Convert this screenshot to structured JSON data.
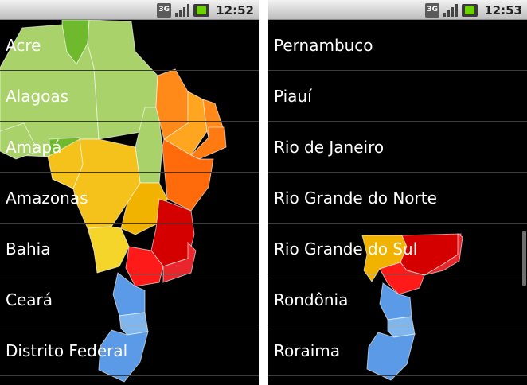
{
  "screens": [
    {
      "status": {
        "time": "12:52",
        "network_label": "3G"
      },
      "items": [
        {
          "label": "Acre"
        },
        {
          "label": "Alagoas"
        },
        {
          "label": "Amapá"
        },
        {
          "label": "Amazonas"
        },
        {
          "label": "Bahia"
        },
        {
          "label": "Ceará"
        },
        {
          "label": "Distrito Federal"
        }
      ]
    },
    {
      "status": {
        "time": "12:53",
        "network_label": "3G"
      },
      "items": [
        {
          "label": "Pernambuco"
        },
        {
          "label": "Piauí"
        },
        {
          "label": "Rio de Janeiro"
        },
        {
          "label": "Rio Grande do Norte"
        },
        {
          "label": "Rio Grande do Sul"
        },
        {
          "label": "Rondônia"
        },
        {
          "label": "Roraima"
        }
      ]
    }
  ],
  "map_colors": {
    "north_light": "#a9d26a",
    "north_dark": "#6fba2c",
    "northeast_orange": "#ff8a1a",
    "northeast_light": "#ffa51f",
    "central_yellow": "#f5c21b",
    "central_gold": "#f2b300",
    "southeast_red": "#d40000",
    "southeast_bright": "#ff1a1a",
    "south_blue": "#5a9ae6",
    "south_light": "#7fb6ee"
  }
}
